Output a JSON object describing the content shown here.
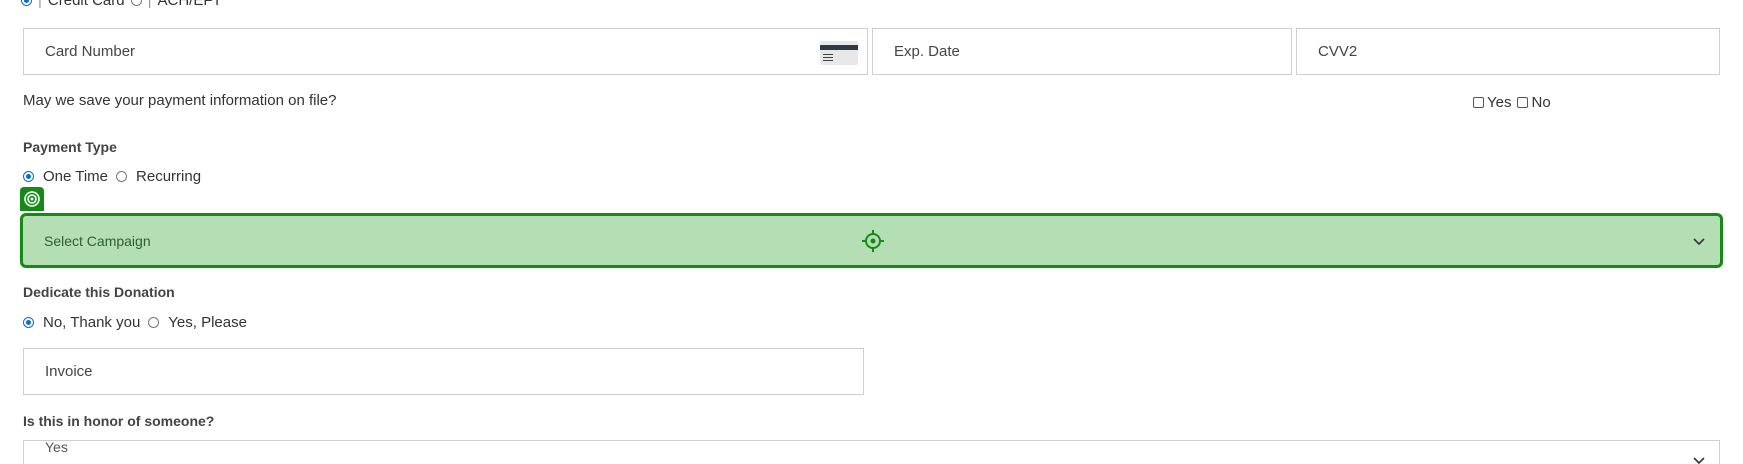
{
  "payment_method": {
    "options": [
      "Credit Card",
      "ACH/EFT"
    ],
    "selected": "Credit Card"
  },
  "card_fields": {
    "card_number_placeholder": "Card Number",
    "exp_date_placeholder": "Exp. Date",
    "cvv_placeholder": "CVV2"
  },
  "save_info": {
    "question": "May we save your payment information on file?",
    "yes_label": "Yes",
    "no_label": "No"
  },
  "payment_type": {
    "heading": "Payment Type",
    "one_time_label": "One Time",
    "recurring_label": "Recurring",
    "selected": "One Time"
  },
  "campaign": {
    "placeholder": "Select Campaign",
    "highlight_color": "#158a16"
  },
  "dedicate": {
    "heading": "Dedicate this Donation",
    "no_label": "No, Thank you",
    "yes_label": "Yes, Please",
    "selected": "No, Thank you"
  },
  "invoice": {
    "placeholder": "Invoice"
  },
  "honor": {
    "heading": "Is this in honor of someone?",
    "selected_value": "Yes"
  },
  "icons": {
    "card": "credit-card-icon",
    "target_badge": "target-badge-icon",
    "crosshair": "crosshair-icon",
    "chevron": "chevron-down-icon"
  }
}
